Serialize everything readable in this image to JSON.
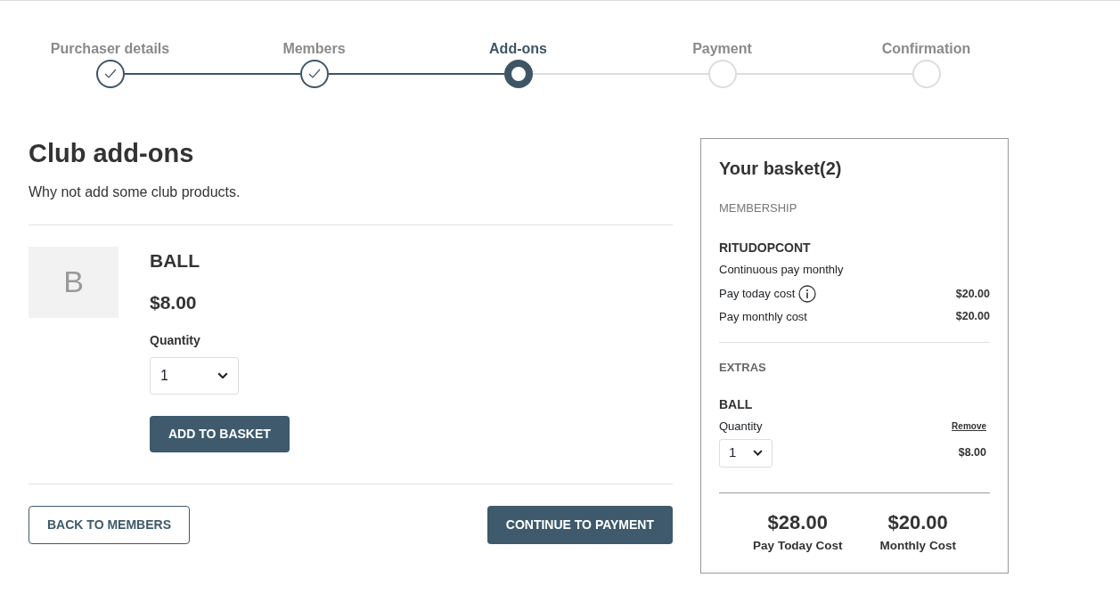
{
  "steps": [
    {
      "label": "Purchaser details",
      "completed": true,
      "selected": false
    },
    {
      "label": "Members",
      "completed": true,
      "selected": false
    },
    {
      "label": "Add-ons",
      "completed": false,
      "selected": true
    },
    {
      "label": "Payment",
      "completed": false,
      "selected": false
    },
    {
      "label": "Confirmation",
      "completed": false,
      "selected": false
    }
  ],
  "heading": "Club add-ons",
  "intro": "Why not add some club products.",
  "products": [
    {
      "initial": "B",
      "name": "BALL",
      "price": "$8.00",
      "quantity_label": "Quantity",
      "quantity": "1",
      "button": "ADD TO BASKET"
    }
  ],
  "back_button": "BACK TO MEMBERS",
  "continue_button": "CONTINUE TO PAYMENT",
  "basket": {
    "title": "Your basket(2)",
    "membership_heading": "MEMBERSHIP",
    "membership": {
      "name": "RITUDOPCONT",
      "plan": "Continuous pay monthly",
      "costs": [
        {
          "label": "Pay today cost",
          "info": true,
          "amount": "$20.00"
        },
        {
          "label": "Pay monthly cost",
          "info": false,
          "amount": "$20.00"
        }
      ]
    },
    "extras_heading": "EXTRAS",
    "extras": [
      {
        "name": "BALL",
        "quantity_label": "Quantity",
        "remove": "Remove",
        "quantity": "1",
        "amount": "$8.00"
      }
    ],
    "totals": [
      {
        "amount": "$28.00",
        "label": "Pay Today Cost"
      },
      {
        "amount": "$20.00",
        "label": "Monthly Cost"
      }
    ]
  }
}
